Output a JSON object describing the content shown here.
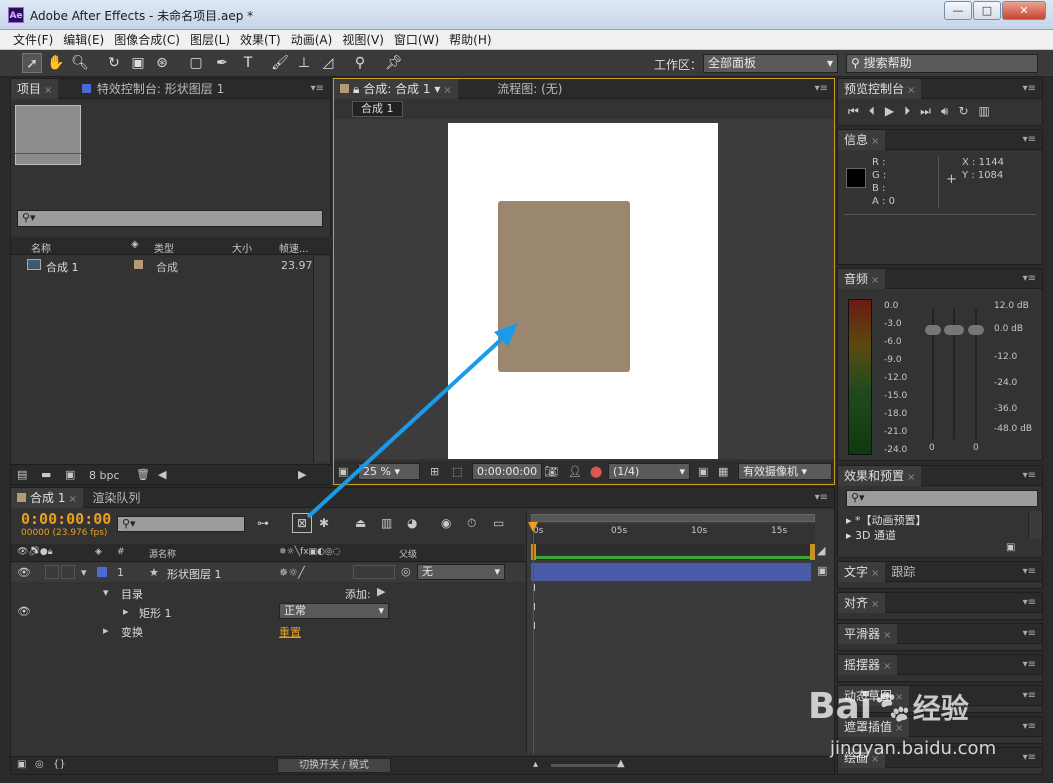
{
  "app": {
    "title": "Adobe After Effects - 未命名项目.aep *",
    "logo": "Ae"
  },
  "window_controls": {
    "minimize": "—",
    "maximize": "□",
    "close": "✕"
  },
  "menu": [
    "文件(F)",
    "编辑(E)",
    "图像合成(C)",
    "图层(L)",
    "效果(T)",
    "动画(A)",
    "视图(V)",
    "窗口(W)",
    "帮助(H)"
  ],
  "toolbar": {
    "workspace_label": "工作区：",
    "workspace_value": "全部面板",
    "search_help": "搜索帮助"
  },
  "project_panel": {
    "tab_project": "项目",
    "tab_effects": "特效控制台: 形状图层 1",
    "columns": [
      "名称",
      "类型",
      "大小",
      "帧速..."
    ],
    "items": [
      {
        "name": "合成 1",
        "type": "合成",
        "fps": "23.976"
      }
    ],
    "bpc": "8 bpc"
  },
  "comp_panel": {
    "tab_comp": "合成: 合成 1",
    "tab_flow": "流程图: (无)",
    "breadcrumb": "合成 1",
    "zoom": "25 %",
    "timecode": "0:00:00:00",
    "resolution": "(1/4)",
    "camera": "有效摄像机"
  },
  "preview_panel": {
    "title": "预览控制台"
  },
  "info_panel": {
    "title": "信息",
    "r": "R :",
    "g": "G :",
    "b": "B :",
    "a": "A : 0",
    "x": "X : 1144",
    "y": "Y : 1084"
  },
  "audio_panel": {
    "title": "音频",
    "left_scale": [
      "0.0",
      "-3.0",
      "-6.0",
      "-9.0",
      "-12.0",
      "-15.0",
      "-18.0",
      "-21.0",
      "-24.0"
    ],
    "right_scale": [
      "12.0 dB",
      "0.0 dB",
      "-12.0",
      "-24.0",
      "-36.0",
      "-48.0 dB"
    ],
    "zero_l": "0",
    "zero_r": "0"
  },
  "effects_panel": {
    "title": "效果和预置",
    "items": [
      "*【动画预置】",
      "3D 通道"
    ]
  },
  "side_panels": {
    "text": "文字",
    "tracking": "跟踪",
    "align": "对齐",
    "smoother": "平滑器",
    "wiggler": "摇摆器",
    "motion_sketch": "动态草图",
    "mask_interp": "遮罩插值",
    "paint": "绘画"
  },
  "timeline": {
    "tab_comp": "合成 1",
    "tab_render": "渲染队列",
    "timecode": "0:00:00:00",
    "fps": "00000 (23.976 fps)",
    "col_source": "源名称",
    "col_parent": "父级",
    "ruler": [
      "0s",
      "05s",
      "10s",
      "15s"
    ],
    "layer_num": "1",
    "layer_name": "形状图层 1",
    "parent_value": "无",
    "contents": "目录",
    "add_label": "添加:",
    "rect": "矩形 1",
    "blend_mode": "正常",
    "transform": "变换",
    "reset": "重置",
    "toggle_modes": "切换开关 / 模式"
  },
  "watermark": {
    "brand": "Bai",
    "brand2": "经验",
    "url": "jingyan.baidu.com"
  },
  "colors": {
    "shape": "#9b8770",
    "accent_orange": "#e8a020",
    "layer_bar": "#4b5ba8",
    "playhead": "#d02020",
    "arrow": "#1a9ae8"
  }
}
